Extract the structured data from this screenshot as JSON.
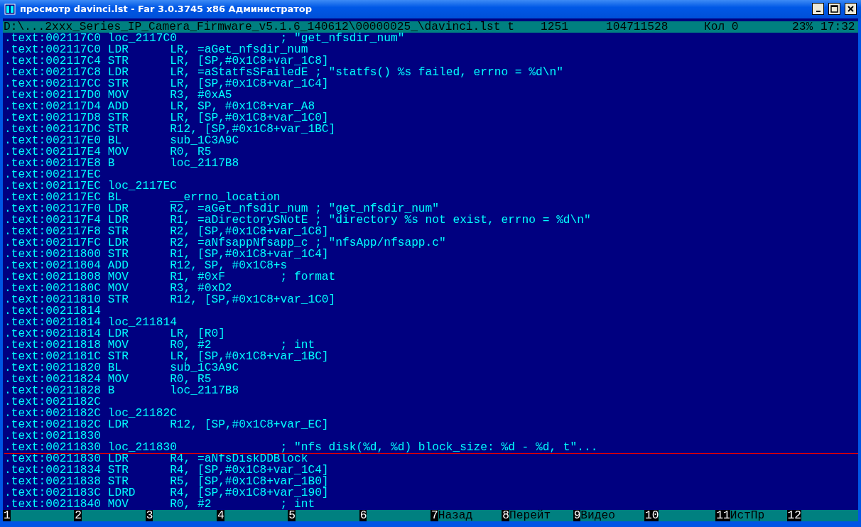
{
  "window": {
    "title": "просмотр davinci.lst - Far 3.0.3745 x86 Администратор"
  },
  "status_bar": {
    "path": "D:\\...2xxx_Series_IP_Camera_Firmware_v5.1.6_140612\\00000025_\\davinci.lst t",
    "line": "1251",
    "size": "104711528",
    "column": "Кол 0",
    "percent": "23%",
    "clock": "17:32"
  },
  "lines": [
    ".text:002117C0 loc_2117C0               ; \"get_nfsdir_num\"",
    ".text:002117C0 LDR      LR, =aGet_nfsdir_num",
    ".text:002117C4 STR      LR, [SP,#0x1C8+var_1C8]",
    ".text:002117C8 LDR      LR, =aStatfsSFailedE ; \"statfs() %s failed, errno = %d\\n\"",
    ".text:002117CC STR      LR, [SP,#0x1C8+var_1C4]",
    ".text:002117D0 MOV      R3, #0xA5",
    ".text:002117D4 ADD      LR, SP, #0x1C8+var_A8",
    ".text:002117D8 STR      LR, [SP,#0x1C8+var_1C0]",
    ".text:002117DC STR      R12, [SP,#0x1C8+var_1BC]",
    ".text:002117E0 BL       sub_1C3A9C",
    ".text:002117E4 MOV      R0, R5",
    ".text:002117E8 B        loc_2117B8",
    ".text:002117EC",
    ".text:002117EC loc_2117EC",
    ".text:002117EC BL       __errno_location",
    ".text:002117F0 LDR      R2, =aGet_nfsdir_num ; \"get_nfsdir_num\"",
    ".text:002117F4 LDR      R1, =aDirectorySNotE ; \"directory %s not exist, errno = %d\\n\"",
    ".text:002117F8 STR      R2, [SP,#0x1C8+var_1C8]",
    ".text:002117FC LDR      R2, =aNfsappNfsapp_c ; \"nfsApp/nfsapp.c\"",
    ".text:00211800 STR      R1, [SP,#0x1C8+var_1C4]",
    ".text:00211804 ADD      R12, SP, #0x1C8+s",
    ".text:00211808 MOV      R1, #0xF        ; format",
    ".text:0021180C MOV      R3, #0xD2",
    ".text:00211810 STR      R12, [SP,#0x1C8+var_1C0]",
    ".text:00211814",
    ".text:00211814 loc_211814",
    ".text:00211814 LDR      LR, [R0]",
    ".text:00211818 MOV      R0, #2          ; int",
    ".text:0021181C STR      LR, [SP,#0x1C8+var_1BC]",
    ".text:00211820 BL       sub_1C3A9C",
    ".text:00211824 MOV      R0, R5",
    ".text:00211828 B        loc_2117B8",
    ".text:0021182C",
    ".text:0021182C loc_21182C",
    ".text:0021182C LDR      R12, [SP,#0x1C8+var_EC]",
    ".text:00211830",
    ".text:00211830 loc_211830               ; \"nfs disk(%d, %d) block_size: %d - %d, t\"...",
    ".text:00211830 LDR      R4, =aNfsDiskDDBlock",
    ".text:00211834 STR      R4, [SP,#0x1C8+var_1C4]",
    ".text:00211838 STR      R5, [SP,#0x1C8+var_1B0]",
    ".text:0021183C LDRD     R4, [SP,#0x1C8+var_190]",
    ".text:00211840 MOV      R0, #2          ; int"
  ],
  "key_bar": [
    {
      "key": "1"
    },
    {
      "key": "2"
    },
    {
      "key": "3"
    },
    {
      "key": "4"
    },
    {
      "key": "5"
    },
    {
      "key": "6"
    },
    {
      "key": "7",
      "label": "Назад"
    },
    {
      "key": "8",
      "label": "Перейт"
    },
    {
      "key": "9",
      "label": "Видео"
    },
    {
      "key": "10"
    },
    {
      "key": "11",
      "label": "ИстПр"
    },
    {
      "key": "12"
    }
  ]
}
